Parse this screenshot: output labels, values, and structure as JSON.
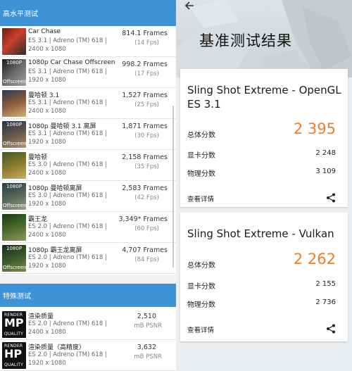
{
  "left": {
    "section1_title": "高水平测试",
    "section2_title": "特殊测试",
    "rows": [
      {
        "title": "Car Chase",
        "sub1": "ES 3.1 | Adreno (TM) 618 |",
        "sub2": "2400 x 1080",
        "score": "814.1 Frames",
        "fps": "(14 Fps)",
        "thumb": "car-chase",
        "tag1": "",
        "tag2": ""
      },
      {
        "title": "1080p Car Chase Offscreen",
        "sub1": "ES 3.1 | Adreno (TM) 618 |",
        "sub2": "1920 x 1080",
        "score": "998.2 Frames",
        "fps": "(17 Fps)",
        "thumb": "car-chase-offscreen",
        "tag1": "1080P",
        "tag2": "Offscreen"
      },
      {
        "title": "曼哈顿 3.1",
        "sub1": "ES 3.1 | Adreno (TM) 618 |",
        "sub2": "2400 x 1080",
        "score": "1,527 Frames",
        "fps": "(25 Fps)",
        "thumb": "manhattan-31",
        "tag1": "",
        "tag2": ""
      },
      {
        "title": "1080p 曼哈顿 3.1 离屏",
        "sub1": "ES 3.1 | Adreno (TM) 618 |",
        "sub2": "1920 x 1080",
        "score": "1,871 Frames",
        "fps": "(30 Fps)",
        "thumb": "manhattan-31-offscreen",
        "tag1": "1080P",
        "tag2": "Offscreen"
      },
      {
        "title": "曼哈顿",
        "sub1": "ES 3.0 | Adreno (TM) 618 |",
        "sub2": "2400 x 1080",
        "score": "2,158 Frames",
        "fps": "(35 Fps)",
        "thumb": "manhattan",
        "tag1": "",
        "tag2": ""
      },
      {
        "title": "1080p 曼哈顿离屏",
        "sub1": "ES 3.0 | Adreno (TM) 618 |",
        "sub2": "1920 x 1080",
        "score": "2,583 Frames",
        "fps": "(42 Fps)",
        "thumb": "manhattan-offscreen",
        "tag1": "1080P",
        "tag2": "Offscreen"
      },
      {
        "title": "霸王龙",
        "sub1": "ES 2.0 | Adreno (TM) 618 |",
        "sub2": "2400 x 1080",
        "score": "3,349* Frames",
        "fps": "(60 Fps)",
        "thumb": "t-rex",
        "tag1": "",
        "tag2": ""
      },
      {
        "title": "1080p 霸王龙离屏",
        "sub1": "ES 2.0 | Adreno (TM) 618 |",
        "sub2": "1920 x 1080",
        "score": "4,707 Frames",
        "fps": "(84 Fps)",
        "thumb": "t-rex-offscreen",
        "tag1": "1080P",
        "tag2": "Offscreen"
      }
    ],
    "special_rows": [
      {
        "title": "渲染质量",
        "sub1": "ES 2.0 | Adreno (TM) 618 |",
        "sub2": "2400 x 1080",
        "score": "2,510",
        "unit": "mB PSNR",
        "badge_top": "RENDER",
        "badge_big": "MP",
        "badge_bottom": "QUALITY"
      },
      {
        "title": "渲染质量（高精度）",
        "sub1": "ES 2.0 | Adreno (TM) 618 |",
        "sub2": "1920 x 1080",
        "score": "3,632",
        "unit": "mB PSNR",
        "badge_top": "RENDER",
        "badge_big": "HP",
        "badge_bottom": "QUALITY"
      }
    ]
  },
  "right": {
    "back_icon": "arrow-left-icon",
    "page_title": "基准测试结果",
    "cards": [
      {
        "title": "Sling Shot Extreme - OpenGL ES 3.1",
        "overall_label": "总体分数",
        "overall_value": "2 395",
        "gpu_label": "显卡分数",
        "gpu_value": "2 248",
        "physics_label": "物理分数",
        "physics_value": "3 109",
        "details_label": "查看详情",
        "share_icon": "share-icon"
      },
      {
        "title": "Sling Shot Extreme - Vulkan",
        "overall_label": "总体分数",
        "overall_value": "2 262",
        "gpu_label": "显卡分数",
        "gpu_value": "2 155",
        "physics_label": "物理分数",
        "physics_value": "2 736",
        "details_label": "查看详情",
        "share_icon": "share-icon"
      }
    ],
    "accent_color": "#f07d28"
  },
  "colors": {
    "header_blue": "#3d93d6",
    "orange": "#f07d28"
  }
}
